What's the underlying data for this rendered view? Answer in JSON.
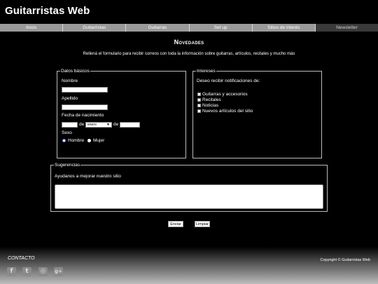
{
  "header": {
    "title": "Guitarristas Web"
  },
  "nav": {
    "items": [
      "Inicio",
      "Guitarristas",
      "Guitarras",
      "Set up",
      "Sitios de interés",
      "Newsletter"
    ],
    "active": "Newsletter"
  },
  "main": {
    "section_title": "Novedades",
    "intro": "Rellená el formulario para recibir correos con toda la información sobre guitarras, artículos, recitales y mucho más"
  },
  "datos": {
    "legend": "Datos básicos",
    "nombre_label": "Nombre",
    "nombre_value": "",
    "apellido_label": "Apellido",
    "apellido_value": "",
    "fecha_label": "Fecha de nacimiento",
    "de1": "de",
    "mes_selected": "enero",
    "de2": "de",
    "sexo_label": "Sexo",
    "sexo_options": [
      "Hombre",
      "Mujer"
    ],
    "sexo_selected": "Hombre"
  },
  "intereses": {
    "legend": "Intereses",
    "prompt": "Deseo recibir notificaciones de:",
    "options": [
      "Guitarras y accesorios",
      "Recitales",
      "Noticias",
      "Nuevos artículos del sitio"
    ]
  },
  "sugerencias": {
    "legend": "Sugerencias",
    "prompt": "Ayudanos a mejorar nuestro sitio",
    "value": ""
  },
  "buttons": {
    "submit": "Enviar",
    "reset": "Limpiar"
  },
  "footer": {
    "contact": "CONTACTO",
    "copyright": "Copyright © Guitarristas Web",
    "social_icons": [
      "facebook-icon",
      "twitter-icon",
      "instagram-icon",
      "google-plus-icon"
    ]
  },
  "colors": {
    "background": "#000000",
    "nav": "#9a9a9a",
    "nav_active": "#3a3a3a",
    "radio_accent": "#4a7bd8"
  }
}
